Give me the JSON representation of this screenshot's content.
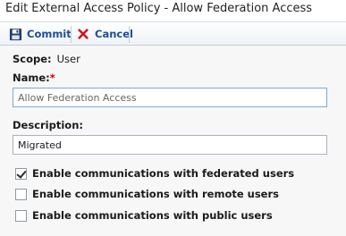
{
  "window": {
    "title": "Edit External Access Policy - Allow Federation Access"
  },
  "toolbar": {
    "commit_label": "Commit",
    "cancel_label": "Cancel",
    "commit_icon": "save-icon",
    "cancel_icon": "close-icon"
  },
  "form": {
    "scope_label": "Scope:",
    "scope_value": "User",
    "name_label": "Name:",
    "name_required_mark": "*",
    "name_value": "Allow Federation Access",
    "description_label": "Description:",
    "description_value": "Migrated",
    "checkboxes": [
      {
        "label": "Enable communications with federated users",
        "checked": true
      },
      {
        "label": "Enable communications with remote users",
        "checked": false
      },
      {
        "label": "Enable communications with public users",
        "checked": false
      }
    ]
  },
  "colors": {
    "toolbar_text": "#1f4e96",
    "required": "#d40000",
    "panel_bg": "#f7f7f7"
  }
}
